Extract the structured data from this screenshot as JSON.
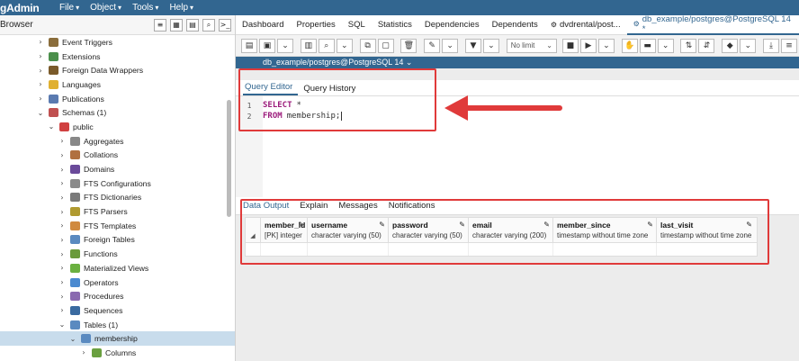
{
  "menubar": {
    "brand": "gAdmin",
    "items": [
      {
        "label": "File"
      },
      {
        "label": "Object"
      },
      {
        "label": "Tools"
      },
      {
        "label": "Help"
      }
    ]
  },
  "browser": {
    "title": "Browser",
    "tree": [
      {
        "label": "Event Triggers",
        "indent": 40,
        "chev": "›",
        "color": "#8a6d3b"
      },
      {
        "label": "Extensions",
        "indent": 40,
        "chev": "›",
        "color": "#4b8f4b"
      },
      {
        "label": "Foreign Data Wrappers",
        "indent": 40,
        "chev": "›",
        "color": "#7a5a2a"
      },
      {
        "label": "Languages",
        "indent": 40,
        "chev": "›",
        "color": "#e0b030"
      },
      {
        "label": "Publications",
        "indent": 40,
        "chev": "›",
        "color": "#5a7ab0"
      },
      {
        "label": "Schemas (1)",
        "indent": 40,
        "chev": "⌄",
        "color": "#c05050"
      },
      {
        "label": "public",
        "indent": 52,
        "chev": "⌄",
        "color": "#d04040"
      },
      {
        "label": "Aggregates",
        "indent": 64,
        "chev": "›",
        "color": "#888888"
      },
      {
        "label": "Collations",
        "indent": 64,
        "chev": "›",
        "color": "#b07040"
      },
      {
        "label": "Domains",
        "indent": 64,
        "chev": "›",
        "color": "#6a4a9a"
      },
      {
        "label": "FTS Configurations",
        "indent": 64,
        "chev": "›",
        "color": "#8a8a8a"
      },
      {
        "label": "FTS Dictionaries",
        "indent": 64,
        "chev": "›",
        "color": "#7a7a7a"
      },
      {
        "label": "FTS Parsers",
        "indent": 64,
        "chev": "›",
        "color": "#b09a30"
      },
      {
        "label": "FTS Templates",
        "indent": 64,
        "chev": "›",
        "color": "#d08a40"
      },
      {
        "label": "Foreign Tables",
        "indent": 64,
        "chev": "›",
        "color": "#5a8ac0"
      },
      {
        "label": "Functions",
        "indent": 64,
        "chev": "›",
        "color": "#6a9a3a"
      },
      {
        "label": "Materialized Views",
        "indent": 64,
        "chev": "›",
        "color": "#6ab040"
      },
      {
        "label": "Operators",
        "indent": 64,
        "chev": "›",
        "color": "#4a8ad0"
      },
      {
        "label": "Procedures",
        "indent": 64,
        "chev": "›",
        "color": "#8a6ab0"
      },
      {
        "label": "Sequences",
        "indent": 64,
        "chev": "›",
        "color": "#3a6aa0"
      },
      {
        "label": "Tables (1)",
        "indent": 64,
        "chev": "⌄",
        "color": "#5a8ac0"
      },
      {
        "label": "membership",
        "indent": 76,
        "chev": "⌄",
        "color": "#5a8ac0"
      },
      {
        "label": "Columns",
        "indent": 88,
        "chev": "›",
        "color": "#6aa040"
      }
    ]
  },
  "tabs": [
    {
      "label": "Dashboard"
    },
    {
      "label": "Properties"
    },
    {
      "label": "SQL"
    },
    {
      "label": "Statistics"
    },
    {
      "label": "Dependencies"
    },
    {
      "label": "Dependents"
    },
    {
      "label": "dvdrental/post..."
    },
    {
      "label": "db_example/postgres@PostgreSQL 14 *"
    }
  ],
  "toolbar": {
    "limit_select": "No limit"
  },
  "connection": {
    "label": "db_example/postgres@PostgreSQL 14 ⌄"
  },
  "editor": {
    "tabs": [
      {
        "label": "Query Editor"
      },
      {
        "label": "Query History"
      }
    ],
    "lines": [
      {
        "num": "1",
        "keyword": "SELECT",
        "rest": "*"
      },
      {
        "num": "2",
        "keyword": "FROM",
        "rest": "membership;"
      }
    ]
  },
  "output": {
    "tabs": [
      {
        "label": "Data Output"
      },
      {
        "label": "Explain"
      },
      {
        "label": "Messages"
      },
      {
        "label": "Notifications"
      }
    ],
    "columns": [
      {
        "name": "member_id",
        "type": "[PK] integer"
      },
      {
        "name": "username",
        "type": "character varying (50)"
      },
      {
        "name": "password",
        "type": "character varying (50)"
      },
      {
        "name": "email",
        "type": "character varying (200)"
      },
      {
        "name": "member_since",
        "type": "timestamp without time zone"
      },
      {
        "name": "last_visit",
        "type": "timestamp without time zone"
      }
    ]
  },
  "colors": {
    "menubar": "#326690",
    "annotation": "#e03a3a",
    "keyword": "#9b1b7b"
  }
}
